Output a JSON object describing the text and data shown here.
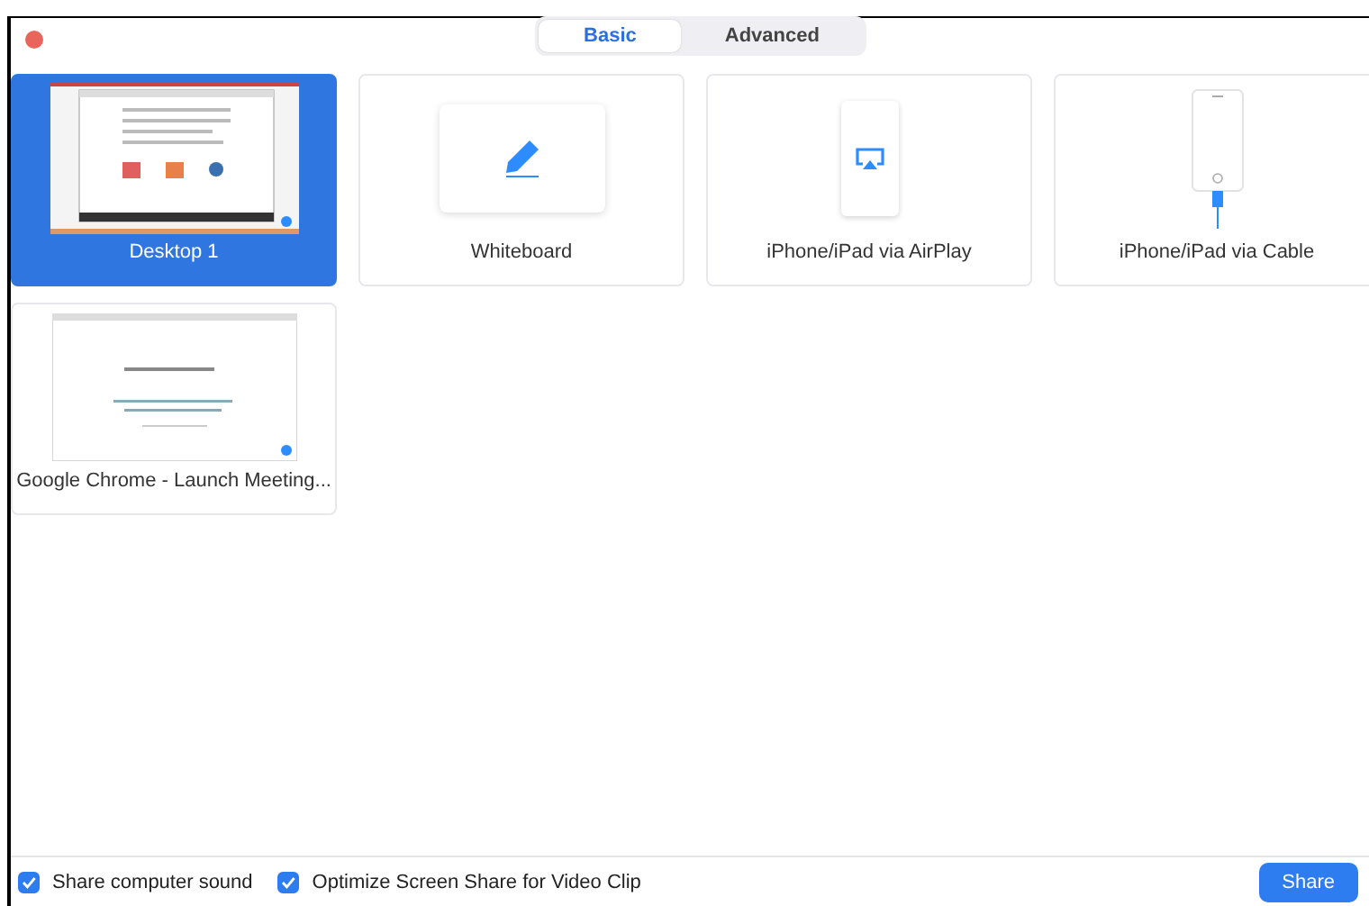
{
  "tabs": [
    {
      "label": "Basic",
      "selected": true
    },
    {
      "label": "Advanced",
      "selected": false
    }
  ],
  "sources": [
    {
      "kind": "desktop",
      "label": "Desktop 1",
      "selected": true
    },
    {
      "kind": "whiteboard",
      "label": "Whiteboard",
      "selected": false
    },
    {
      "kind": "airplay",
      "label": "iPhone/iPad via AirPlay",
      "selected": false
    },
    {
      "kind": "cable",
      "label": "iPhone/iPad via Cable",
      "selected": false
    },
    {
      "kind": "window",
      "label": "Google Chrome - Launch Meeting...",
      "selected": false
    }
  ],
  "options": [
    {
      "label": "Share computer sound",
      "checked": true
    },
    {
      "label": "Optimize Screen Share for Video Clip",
      "checked": true
    }
  ],
  "share_button": "Share"
}
